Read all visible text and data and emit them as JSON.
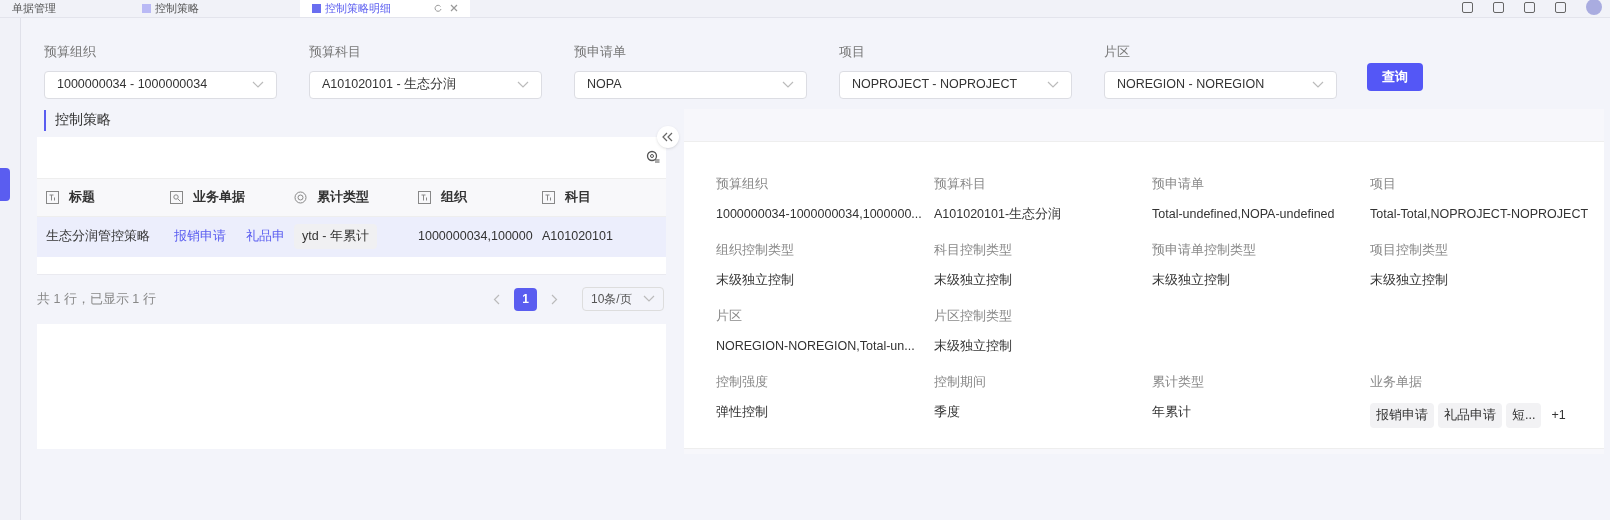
{
  "tabs": [
    {
      "label": "单据管理",
      "selected": false,
      "closable": false
    },
    {
      "label": "控制策略",
      "selected": false,
      "closable": false
    },
    {
      "label": "控制策略明细",
      "selected": true,
      "closable": true
    }
  ],
  "filters": [
    {
      "label": "预算组织",
      "value": "1000000034 - 1000000034"
    },
    {
      "label": "预算科目",
      "value": "A101020101 - 生态分润"
    },
    {
      "label": "预申请单",
      "value": "NOPA"
    },
    {
      "label": "项目",
      "value": "NOPROJECT - NOPROJECT"
    },
    {
      "label": "片区",
      "value": "NOREGION - NOREGION"
    }
  ],
  "query_button": "查询",
  "section_title": "控制策略",
  "table": {
    "columns": [
      {
        "label": "标题",
        "kind": "text"
      },
      {
        "label": "业务单据",
        "kind": "link"
      },
      {
        "label": "累计类型",
        "kind": "select"
      },
      {
        "label": "组织",
        "kind": "text"
      },
      {
        "label": "科目",
        "kind": "text"
      }
    ],
    "rows": [
      {
        "selected": true,
        "cells": [
          {
            "kind": "text",
            "text": "生态分润管控策略"
          },
          {
            "kind": "links",
            "links": [
              "报销申请",
              "礼品申"
            ]
          },
          {
            "kind": "tag",
            "text": "ytd - 年累计"
          },
          {
            "kind": "text",
            "text": "1000000034,100000"
          },
          {
            "kind": "text",
            "text": "A101020101"
          }
        ]
      }
    ]
  },
  "pagination": {
    "summary": "共 1 行，已显示 1 行",
    "pages": [
      {
        "label": "1",
        "selected": true
      }
    ],
    "page_size": "10条/页"
  },
  "details": [
    [
      {
        "label": "预算组织",
        "value": "1000000034-1000000034,1000000..."
      },
      {
        "label": "预算科目",
        "value": "A101020101-生态分润"
      },
      {
        "label": "预申请单",
        "value": "Total-undefined,NOPA-undefined"
      },
      {
        "label": "项目",
        "value": "Total-Total,NOPROJECT-NOPROJECT"
      }
    ],
    [
      {
        "label": "组织控制类型",
        "value": "末级独立控制"
      },
      {
        "label": "科目控制类型",
        "value": "末级独立控制"
      },
      {
        "label": "预申请单控制类型",
        "value": "末级独立控制"
      },
      {
        "label": "项目控制类型",
        "value": "末级独立控制"
      }
    ],
    [
      {
        "label": "片区",
        "value": "NOREGION-NOREGION,Total-un..."
      },
      {
        "label": "片区控制类型",
        "value": "末级独立控制"
      }
    ],
    [
      {
        "label": "控制强度",
        "value": "弹性控制"
      },
      {
        "label": "控制期间",
        "value": "季度"
      },
      {
        "label": "累计类型",
        "value": "年累计"
      },
      {
        "label": "业务单据",
        "tags": [
          "报销申请",
          "礼品申请",
          "短..."
        ],
        "more": "+1"
      }
    ]
  ]
}
